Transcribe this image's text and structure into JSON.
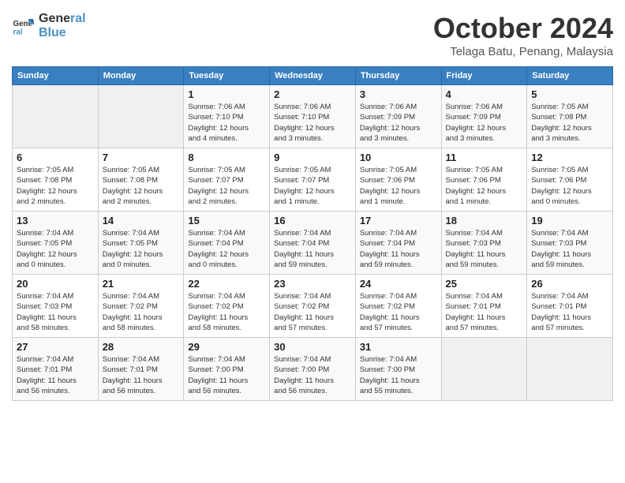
{
  "header": {
    "logo_line1": "General",
    "logo_line2": "Blue",
    "month": "October 2024",
    "location": "Telaga Batu, Penang, Malaysia"
  },
  "columns": [
    "Sunday",
    "Monday",
    "Tuesday",
    "Wednesday",
    "Thursday",
    "Friday",
    "Saturday"
  ],
  "weeks": [
    [
      {
        "day": "",
        "info": ""
      },
      {
        "day": "",
        "info": ""
      },
      {
        "day": "1",
        "info": "Sunrise: 7:06 AM\nSunset: 7:10 PM\nDaylight: 12 hours\nand 4 minutes."
      },
      {
        "day": "2",
        "info": "Sunrise: 7:06 AM\nSunset: 7:10 PM\nDaylight: 12 hours\nand 3 minutes."
      },
      {
        "day": "3",
        "info": "Sunrise: 7:06 AM\nSunset: 7:09 PM\nDaylight: 12 hours\nand 3 minutes."
      },
      {
        "day": "4",
        "info": "Sunrise: 7:06 AM\nSunset: 7:09 PM\nDaylight: 12 hours\nand 3 minutes."
      },
      {
        "day": "5",
        "info": "Sunrise: 7:05 AM\nSunset: 7:08 PM\nDaylight: 12 hours\nand 3 minutes."
      }
    ],
    [
      {
        "day": "6",
        "info": "Sunrise: 7:05 AM\nSunset: 7:08 PM\nDaylight: 12 hours\nand 2 minutes."
      },
      {
        "day": "7",
        "info": "Sunrise: 7:05 AM\nSunset: 7:08 PM\nDaylight: 12 hours\nand 2 minutes."
      },
      {
        "day": "8",
        "info": "Sunrise: 7:05 AM\nSunset: 7:07 PM\nDaylight: 12 hours\nand 2 minutes."
      },
      {
        "day": "9",
        "info": "Sunrise: 7:05 AM\nSunset: 7:07 PM\nDaylight: 12 hours\nand 1 minute."
      },
      {
        "day": "10",
        "info": "Sunrise: 7:05 AM\nSunset: 7:06 PM\nDaylight: 12 hours\nand 1 minute."
      },
      {
        "day": "11",
        "info": "Sunrise: 7:05 AM\nSunset: 7:06 PM\nDaylight: 12 hours\nand 1 minute."
      },
      {
        "day": "12",
        "info": "Sunrise: 7:05 AM\nSunset: 7:06 PM\nDaylight: 12 hours\nand 0 minutes."
      }
    ],
    [
      {
        "day": "13",
        "info": "Sunrise: 7:04 AM\nSunset: 7:05 PM\nDaylight: 12 hours\nand 0 minutes."
      },
      {
        "day": "14",
        "info": "Sunrise: 7:04 AM\nSunset: 7:05 PM\nDaylight: 12 hours\nand 0 minutes."
      },
      {
        "day": "15",
        "info": "Sunrise: 7:04 AM\nSunset: 7:04 PM\nDaylight: 12 hours\nand 0 minutes."
      },
      {
        "day": "16",
        "info": "Sunrise: 7:04 AM\nSunset: 7:04 PM\nDaylight: 11 hours\nand 59 minutes."
      },
      {
        "day": "17",
        "info": "Sunrise: 7:04 AM\nSunset: 7:04 PM\nDaylight: 11 hours\nand 59 minutes."
      },
      {
        "day": "18",
        "info": "Sunrise: 7:04 AM\nSunset: 7:03 PM\nDaylight: 11 hours\nand 59 minutes."
      },
      {
        "day": "19",
        "info": "Sunrise: 7:04 AM\nSunset: 7:03 PM\nDaylight: 11 hours\nand 59 minutes."
      }
    ],
    [
      {
        "day": "20",
        "info": "Sunrise: 7:04 AM\nSunset: 7:03 PM\nDaylight: 11 hours\nand 58 minutes."
      },
      {
        "day": "21",
        "info": "Sunrise: 7:04 AM\nSunset: 7:02 PM\nDaylight: 11 hours\nand 58 minutes."
      },
      {
        "day": "22",
        "info": "Sunrise: 7:04 AM\nSunset: 7:02 PM\nDaylight: 11 hours\nand 58 minutes."
      },
      {
        "day": "23",
        "info": "Sunrise: 7:04 AM\nSunset: 7:02 PM\nDaylight: 11 hours\nand 57 minutes."
      },
      {
        "day": "24",
        "info": "Sunrise: 7:04 AM\nSunset: 7:02 PM\nDaylight: 11 hours\nand 57 minutes."
      },
      {
        "day": "25",
        "info": "Sunrise: 7:04 AM\nSunset: 7:01 PM\nDaylight: 11 hours\nand 57 minutes."
      },
      {
        "day": "26",
        "info": "Sunrise: 7:04 AM\nSunset: 7:01 PM\nDaylight: 11 hours\nand 57 minutes."
      }
    ],
    [
      {
        "day": "27",
        "info": "Sunrise: 7:04 AM\nSunset: 7:01 PM\nDaylight: 11 hours\nand 56 minutes."
      },
      {
        "day": "28",
        "info": "Sunrise: 7:04 AM\nSunset: 7:01 PM\nDaylight: 11 hours\nand 56 minutes."
      },
      {
        "day": "29",
        "info": "Sunrise: 7:04 AM\nSunset: 7:00 PM\nDaylight: 11 hours\nand 56 minutes."
      },
      {
        "day": "30",
        "info": "Sunrise: 7:04 AM\nSunset: 7:00 PM\nDaylight: 11 hours\nand 56 minutes."
      },
      {
        "day": "31",
        "info": "Sunrise: 7:04 AM\nSunset: 7:00 PM\nDaylight: 11 hours\nand 55 minutes."
      },
      {
        "day": "",
        "info": ""
      },
      {
        "day": "",
        "info": ""
      }
    ]
  ]
}
